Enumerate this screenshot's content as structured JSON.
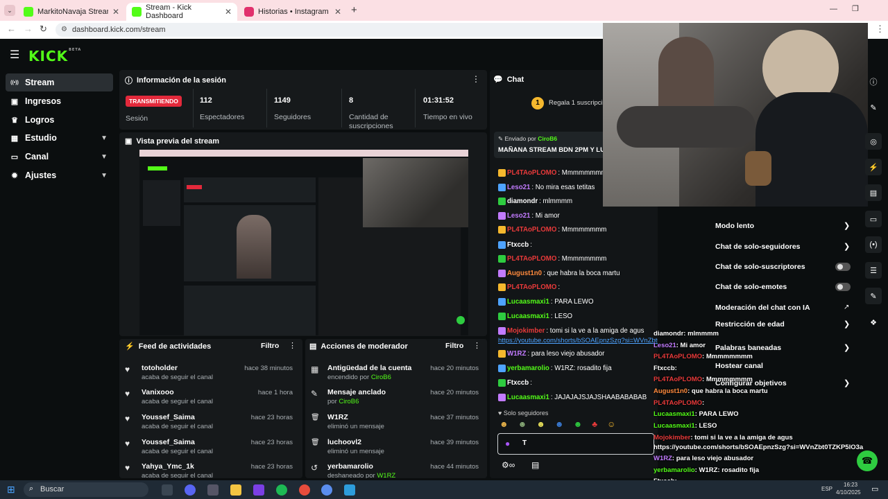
{
  "browser": {
    "tabs": [
      {
        "title": "MarkitoNavaja Stream - Watch",
        "color": "#53fc18"
      },
      {
        "title": "Stream - Kick Dashboard",
        "color": "#53fc18"
      },
      {
        "title": "Historias • Instagram",
        "color": "#e1306c"
      }
    ],
    "url": "dashboard.kick.com/stream"
  },
  "brand": {
    "logo": "KICK",
    "beta": "BETA"
  },
  "sidebar": [
    {
      "label": "Stream",
      "icon": "broadcast-icon",
      "glyph": "((•))"
    },
    {
      "label": "Ingresos",
      "icon": "money-icon",
      "glyph": "▣"
    },
    {
      "label": "Logros",
      "icon": "trophy-icon",
      "glyph": "♛"
    },
    {
      "label": "Estudio",
      "icon": "studio-icon",
      "glyph": "▦"
    },
    {
      "label": "Canal",
      "icon": "tv-icon",
      "glyph": "▭"
    },
    {
      "label": "Ajustes",
      "icon": "gear-icon",
      "glyph": "✹"
    }
  ],
  "session": {
    "title": "Información de la sesión",
    "live_badge": "TRANSMITIENDO",
    "session_label": "Sesión",
    "stats": [
      {
        "value": "112",
        "label": "Espectadores"
      },
      {
        "value": "1149",
        "label": "Seguidores"
      },
      {
        "value": "8",
        "label": "Cantidad de suscripciones"
      },
      {
        "value": "01:31:52",
        "label": "Tiempo en vivo"
      }
    ]
  },
  "preview": {
    "title": "Vista previa del stream"
  },
  "feed": {
    "title": "Feed de actividades",
    "filter": "Filtro",
    "items": [
      {
        "name": "totoholder",
        "sub": "acaba de seguir el canal",
        "time": "hace 38 minutos"
      },
      {
        "name": "Vanixooo",
        "sub": "acaba de seguir el canal",
        "time": "hace 1 hora"
      },
      {
        "name": "Youssef_Saima",
        "sub": "acaba de seguir el canal",
        "time": "hace 23 horas"
      },
      {
        "name": "Youssef_Saima",
        "sub": "acaba de seguir el canal",
        "time": "hace 23 horas"
      },
      {
        "name": "Yahya_Ymc_1k",
        "sub": "acaba de seguir el canal",
        "time": "hace 23 horas"
      }
    ]
  },
  "modactions": {
    "title": "Acciones de moderador",
    "filter": "Filtro",
    "items": [
      {
        "title": "Antigüedad de la cuenta",
        "sub": "encendido por ",
        "by": "CiroB6",
        "time": "hace 20 minutos",
        "icon": "calendar-icon",
        "glyph": "▦"
      },
      {
        "title": "Mensaje anclado",
        "sub": "por ",
        "by": "CiroB6",
        "time": "hace 20 minutos",
        "icon": "pin-icon",
        "glyph": "✎"
      },
      {
        "title": "W1RZ",
        "sub": "eliminó un mensaje",
        "by": "",
        "time": "hace 37 minutos",
        "icon": "trash-icon",
        "glyph": "🗑"
      },
      {
        "title": "luchoovl2",
        "sub": "eliminó un mensaje",
        "by": "",
        "time": "hace 39 minutos",
        "icon": "trash-icon",
        "glyph": "🗑"
      },
      {
        "title": "yerbamarolio",
        "sub": "deshaneado por ",
        "by": "W1RZ",
        "time": "hace 44 minutos",
        "icon": "undo-icon",
        "glyph": "↺"
      }
    ]
  },
  "chat": {
    "title": "Chat",
    "gift": "Regala 1 suscripción",
    "gift_count": "1",
    "pinned_by": "Enviado por",
    "pinned_user": "CiroB6",
    "pinned_text": "MAÑANA STREAM BDN 2PM Y LUEGO",
    "messages": [
      {
        "user": "PL4TAoPLOMO",
        "text": ": Mmmmmmmm",
        "color": "#e83a3a"
      },
      {
        "user": "Leso21",
        "text": ": No mira esas tetitas",
        "color": "#c27bff"
      },
      {
        "user": "diamondr",
        "text": ": mlmmmm",
        "color": "#fff"
      },
      {
        "user": "Leso21",
        "text": ": Mi amor",
        "color": "#c27bff"
      },
      {
        "user": "PL4TAoPLOMO",
        "text": ": Mmmmmmmm",
        "color": "#e83a3a"
      },
      {
        "user": "Ftxccb",
        "text": ":",
        "color": "#fff"
      },
      {
        "user": "PL4TAoPLOMO",
        "text": ": Mmmmmmmm",
        "color": "#e83a3a"
      },
      {
        "user": "August1n0",
        "text": ": que habra la boca martu",
        "color": "#ff8a3d"
      },
      {
        "user": "PL4TAoPLOMO",
        "text": ":",
        "color": "#e83a3a"
      },
      {
        "user": "Lucaasmaxi1",
        "text": ": PARA LEWO",
        "color": "#53fc18"
      },
      {
        "user": "Lucaasmaxi1",
        "text": ": LESO",
        "color": "#53fc18"
      },
      {
        "user": "Mojokimber",
        "text": ": tomi si la ve a la amiga de agus",
        "color": "#e83a3a"
      },
      {
        "user": "W1RZ",
        "text": ": para leso viejo abusador",
        "color": "#c27bff"
      },
      {
        "user": "yerbamarolio",
        "text": ": W1RZ: rosadito fija",
        "color": "#53fc18"
      },
      {
        "user": "Ftxccb",
        "text": ":",
        "color": "#fff"
      },
      {
        "user": "Lucaasmaxi1",
        "text": ": JAJAJAJSJAJSHAABABABAB",
        "color": "#53fc18"
      }
    ],
    "link": "https://youtube.com/shorts/bSOAEpnzSzg?si=WVnZbt0TZKP5lO3a",
    "mode": "Solo seguidores",
    "input_value": "T"
  },
  "settings": [
    {
      "label": "Modo lento",
      "kind": "arrow"
    },
    {
      "label": "Chat de solo-seguidores",
      "kind": "arrow"
    },
    {
      "label": "Chat de solo-suscriptores",
      "kind": "toggle"
    },
    {
      "label": "Chat de solo-emotes",
      "kind": "toggle"
    },
    {
      "label": "Moderación del chat con IA",
      "kind": "link"
    },
    {
      "label": "Restricción de edad",
      "kind": "arrow"
    },
    {
      "label": "Palabras baneadas",
      "kind": "arrow"
    },
    {
      "label": "Hostear canal",
      "kind": "none"
    },
    {
      "label": "Configurar objetivos",
      "kind": "arrow"
    }
  ],
  "overlay_chat": [
    {
      "user": "diamondr",
      "text": ": mlmmmm",
      "color": "#fff"
    },
    {
      "user": "Leso21",
      "text": ": Mi amor",
      "color": "#c27bff"
    },
    {
      "user": "PL4TAoPLOMO",
      "text": ": Mmmmmmmm",
      "color": "#e83a3a"
    },
    {
      "user": "Ftxccb",
      "text": ":",
      "color": "#fff"
    },
    {
      "user": "PL4TAoPLOMO",
      "text": ": Mmmmmmmm",
      "color": "#e83a3a"
    },
    {
      "user": "August1n0",
      "text": ": que habra la boca martu",
      "color": "#ff8a3d"
    },
    {
      "user": "PL4TAoPLOMO",
      "text": ":",
      "color": "#e83a3a"
    },
    {
      "user": "Lucaasmaxi1",
      "text": ": PARA LEWO",
      "color": "#53fc18"
    },
    {
      "user": "Lucaasmaxi1",
      "text": ": LESO",
      "color": "#53fc18"
    },
    {
      "user": "Mojokimber",
      "text": ": tomi si la ve a la amiga de agus",
      "color": "#e83a3a"
    },
    {
      "user": "",
      "text": "https://youtube.com/shorts/bSOAEpnzSzg?si=WVnZbt0TZKP5lO3a",
      "color": "#fff"
    },
    {
      "user": "W1RZ",
      "text": ": para leso viejo abusador",
      "color": "#c27bff"
    },
    {
      "user": "yerbamarolio",
      "text": ": W1RZ: rosadito fija",
      "color": "#53fc18"
    },
    {
      "user": "Ftxccb",
      "text": ":",
      "color": "#fff"
    },
    {
      "user": "Lucaasmaxi1",
      "text": ": JAJAJAJSJAJSHAABABABAB",
      "color": "#53fc18"
    }
  ],
  "taskbar": {
    "search": "Buscar",
    "time": "16:23",
    "date": "4/10/2025",
    "lang": "ESP"
  }
}
